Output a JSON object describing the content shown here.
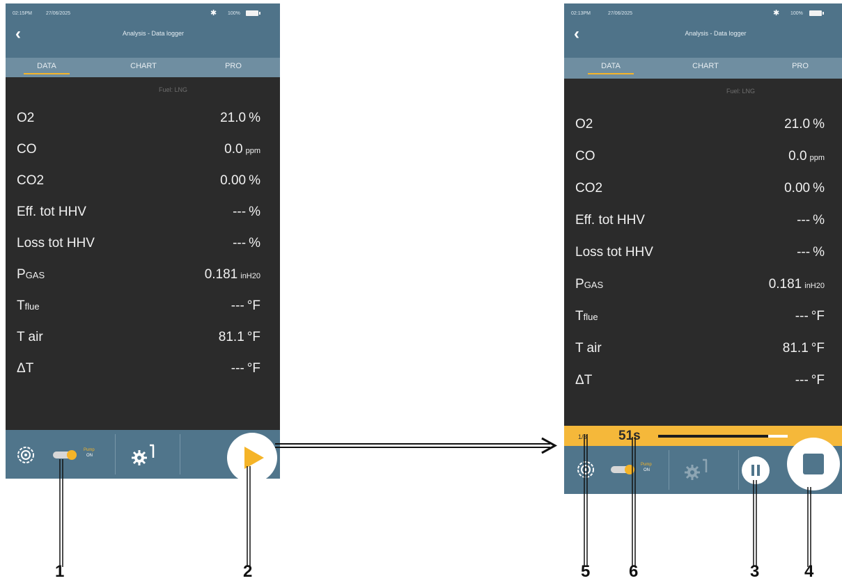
{
  "left": {
    "status": {
      "time": "02:15PM",
      "date": "27/06/2025",
      "battery": "100%"
    },
    "title": "Analysis - Data logger",
    "tabs": [
      "DATA",
      "CHART",
      "PRO"
    ],
    "fuel": "Fuel: LNG",
    "rows": [
      {
        "label": "O2",
        "value": "21.0",
        "unit": "%"
      },
      {
        "label": "CO",
        "value": "0.0",
        "unit": "ppm"
      },
      {
        "label": "CO2",
        "value": "0.00",
        "unit": "%"
      },
      {
        "label": "Eff. tot HHV",
        "value": "---",
        "unit": "%"
      },
      {
        "label": "Loss tot HHV",
        "value": "---",
        "unit": "%"
      },
      {
        "label": "P",
        "label_sub": "GAS",
        "value": "0.181",
        "unit": "inH20"
      },
      {
        "label": "T",
        "label_sub": "flue",
        "value": "---",
        "unit": "°F"
      },
      {
        "label": "T air",
        "value": "81.1",
        "unit": "°F"
      },
      {
        "label": "ΔT",
        "value": "---",
        "unit": "°F"
      }
    ],
    "pump": {
      "line1": "Pump",
      "line2": "ON"
    }
  },
  "right": {
    "status": {
      "time": "02:13PM",
      "date": "27/06/2025",
      "battery": "100%"
    },
    "title": "Analysis - Data logger",
    "tabs": [
      "DATA",
      "CHART",
      "PRO"
    ],
    "fuel": "Fuel: LNG",
    "rows": [
      {
        "label": "O2",
        "value": "21.0",
        "unit": "%"
      },
      {
        "label": "CO",
        "value": "0.0",
        "unit": "ppm"
      },
      {
        "label": "CO2",
        "value": "0.00",
        "unit": "%"
      },
      {
        "label": "Eff. tot HHV",
        "value": "---",
        "unit": "%"
      },
      {
        "label": "Loss tot HHV",
        "value": "---",
        "unit": "%"
      },
      {
        "label": "P",
        "label_sub": "GAS",
        "value": "0.181",
        "unit": "inH20"
      },
      {
        "label": "T",
        "label_sub": "flue",
        "value": "---",
        "unit": "°F"
      },
      {
        "label": "T air",
        "value": "81.1",
        "unit": "°F"
      },
      {
        "label": "ΔT",
        "value": "---",
        "unit": "°F"
      }
    ],
    "pump": {
      "line1": "Pump",
      "line2": "ON"
    },
    "progress": {
      "count": "1/3",
      "elapsed": "51s",
      "fraction": 0.85
    }
  },
  "callouts": [
    "1",
    "2",
    "3",
    "4",
    "5",
    "6"
  ],
  "colors": {
    "header": "#4f7389",
    "tabs": "#6f8ea1",
    "accent": "#f5b428",
    "screen": "#2b2b2b"
  },
  "icons": [
    "back-arrow-icon",
    "bluetooth-icon",
    "battery-icon",
    "probe-target-icon",
    "toggle-switch-icon",
    "settings-probe-icon",
    "play-icon",
    "pause-icon",
    "stop-icon"
  ]
}
